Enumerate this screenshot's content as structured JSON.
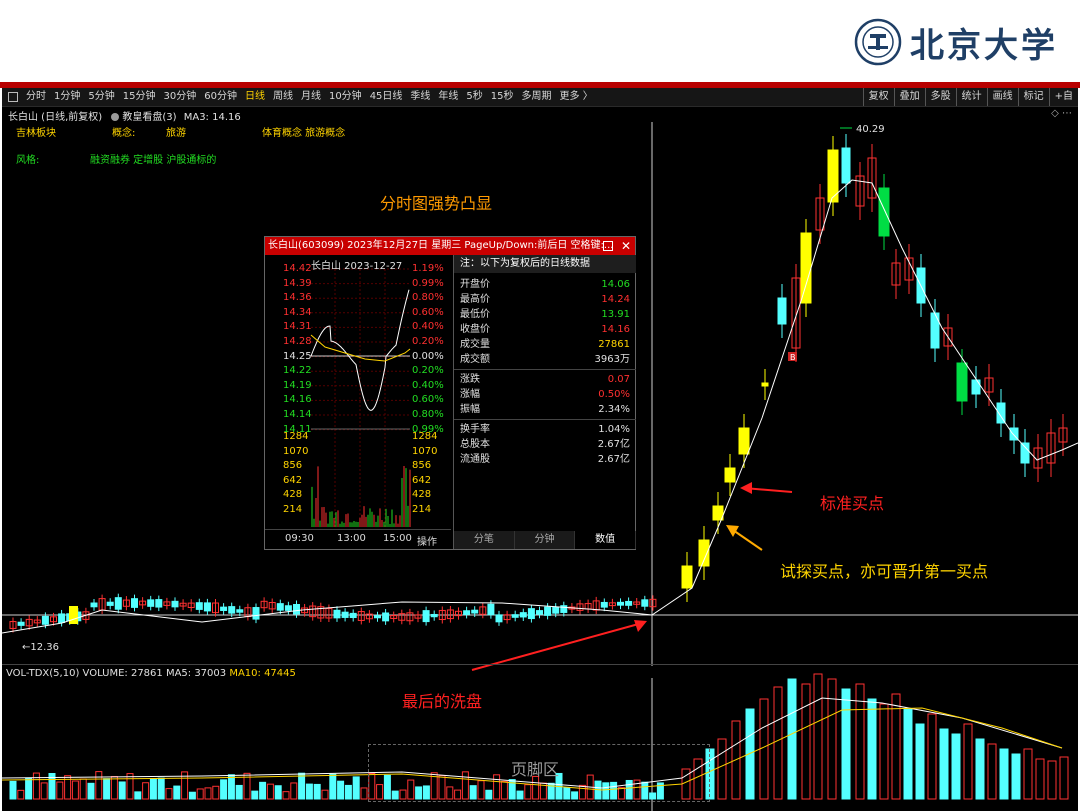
{
  "logo": {
    "text": "北京大学",
    "emblem": "pku-emblem"
  },
  "toolbar": {
    "periods": [
      "分时",
      "1分钟",
      "5分钟",
      "15分钟",
      "30分钟",
      "60分钟",
      "日线",
      "周线",
      "月线",
      "10分钟",
      "45日线",
      "季线",
      "年线",
      "5秒",
      "15秒",
      "多周期",
      "更多 〉"
    ],
    "active_period": "日线",
    "right": [
      "复权",
      "叠加",
      "多股",
      "统计",
      "画线",
      "标记",
      "+自"
    ]
  },
  "stock_info": {
    "title": "长白山 (日线,前复权)",
    "indicator": "教皇看盘(3)",
    "ma": "MA3: 14.16"
  },
  "tags": {
    "board_label": "吉林板块",
    "concept_label": "概念:",
    "concept_value": "旅游",
    "concept2": "体育概念 旅游概念",
    "style_label": "风格:",
    "style_value": "融资融券 定增股 沪股通标的"
  },
  "annotations": {
    "title": "分时图强势凸显",
    "std_buy": "标准买点",
    "probe_buy": "试探买点，亦可晋升第一买点",
    "last_wash": "最后的洗盘",
    "footer": "页脚区",
    "high": "40.29",
    "low": "←12.36",
    "marker": "B"
  },
  "volume_info": {
    "label": "VOL-TDX(5,10) VOLUME: 27861 MA5: 37003",
    "ma10": "MA10: 47445"
  },
  "popup": {
    "title": "长白山(603099) 2023年12月27日 星期三 PageUp/Down:前后日 空格键:...",
    "mini_head": "长白山  2023-12-27",
    "left_axis": [
      "14.42",
      "14.39",
      "14.36",
      "14.34",
      "14.31",
      "14.28",
      "14.25",
      "14.22",
      "14.19",
      "14.16",
      "14.14",
      "14.11",
      "1284",
      "1070",
      "856",
      "642",
      "428",
      "214"
    ],
    "right_axis": [
      "1.19%",
      "0.99%",
      "0.80%",
      "0.60%",
      "0.40%",
      "0.20%",
      "0.00%",
      "0.20%",
      "0.40%",
      "0.60%",
      "0.80%",
      "0.99%",
      "1284",
      "1070",
      "856",
      "642",
      "428",
      "214"
    ],
    "time_labels": [
      "09:30",
      "13:00",
      "15:00"
    ],
    "op_label": "操作",
    "quote_head": "注：以下为复权后的日线数据",
    "rows": [
      {
        "label": "开盘价",
        "value": "14.06",
        "color": "#22dd22"
      },
      {
        "label": "最高价",
        "value": "14.24",
        "color": "#ff3030"
      },
      {
        "label": "最低价",
        "value": "13.91",
        "color": "#22dd22"
      },
      {
        "label": "收盘价",
        "value": "14.16",
        "color": "#ff3030"
      },
      {
        "label": "成交量",
        "value": "27861",
        "color": "#ffd400"
      },
      {
        "label": "成交额",
        "value": "3963万",
        "color": "#e0e0e0"
      },
      {
        "label": "涨跌",
        "value": "0.07",
        "color": "#ff3030"
      },
      {
        "label": "涨幅",
        "value": "0.50%",
        "color": "#ff3030"
      },
      {
        "label": "振幅",
        "value": "2.34%",
        "color": "#e0e0e0"
      },
      {
        "label": "换手率",
        "value": "1.04%",
        "color": "#e0e0e0"
      },
      {
        "label": "总股本",
        "value": "2.67亿",
        "color": "#e0e0e0"
      },
      {
        "label": "流通股",
        "value": "2.67亿",
        "color": "#e0e0e0"
      }
    ],
    "tabs": [
      "分笔",
      "分钟",
      "数值"
    ],
    "active_tab": "数值"
  },
  "colors": {
    "up": "#ff3232",
    "down": "#54ffff",
    "yellow": "#ffff00",
    "green": "#00dd44",
    "red_line": "#b80000"
  }
}
